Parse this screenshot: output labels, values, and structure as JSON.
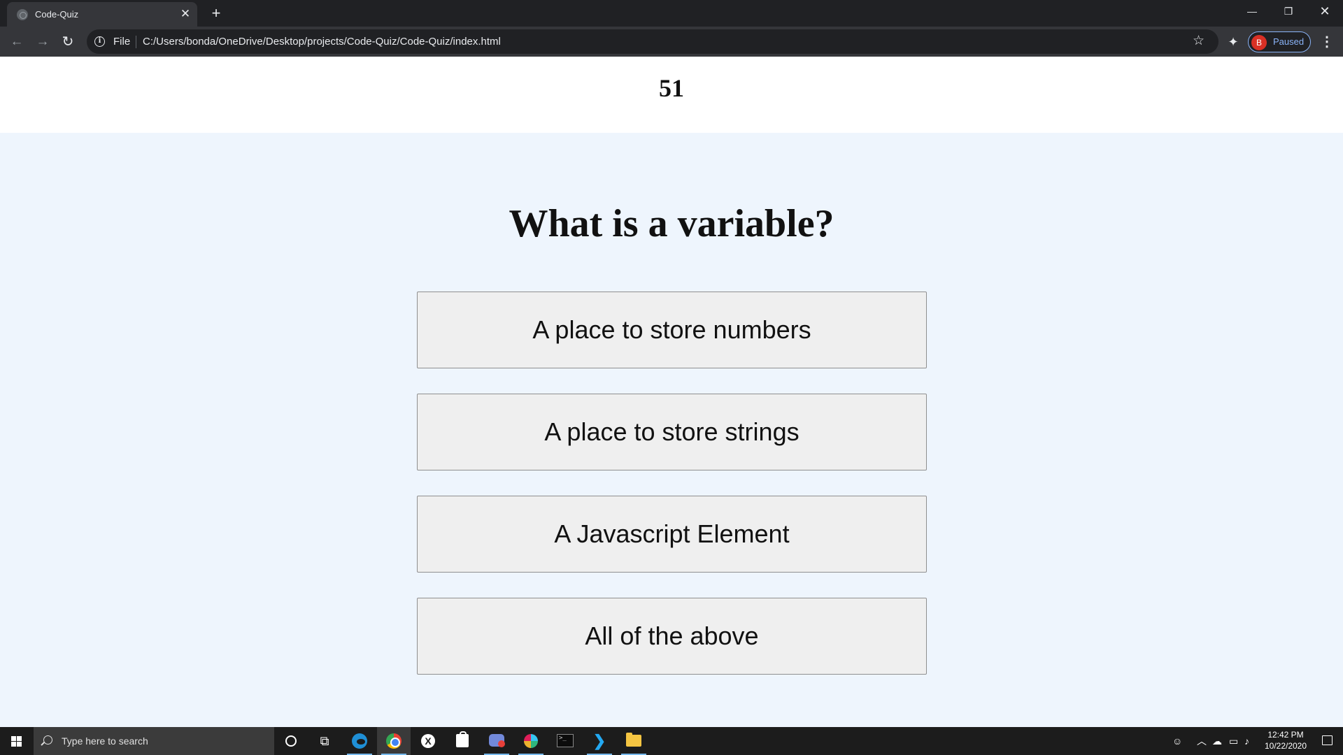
{
  "browser": {
    "tab": {
      "title": "Code-Quiz"
    },
    "address": {
      "scheme_label": "File",
      "url": "C:/Users/bonda/OneDrive/Desktop/projects/Code-Quiz/Code-Quiz/index.html"
    },
    "profile": {
      "initial": "B",
      "status": "Paused"
    }
  },
  "quiz": {
    "timer": "51",
    "question": "What is a variable?",
    "choices": [
      "A place to store numbers",
      "A place to store strings",
      "A Javascript Element",
      "All of the above"
    ]
  },
  "taskbar": {
    "search_placeholder": "Type here to search",
    "clock": {
      "time": "12:42 PM",
      "date": "10/22/2020"
    }
  },
  "colors": {
    "page_background": "#eef5fd",
    "button_background": "#efefef",
    "browser_frame": "#202124",
    "profile_accent": "#8ab4f8"
  }
}
